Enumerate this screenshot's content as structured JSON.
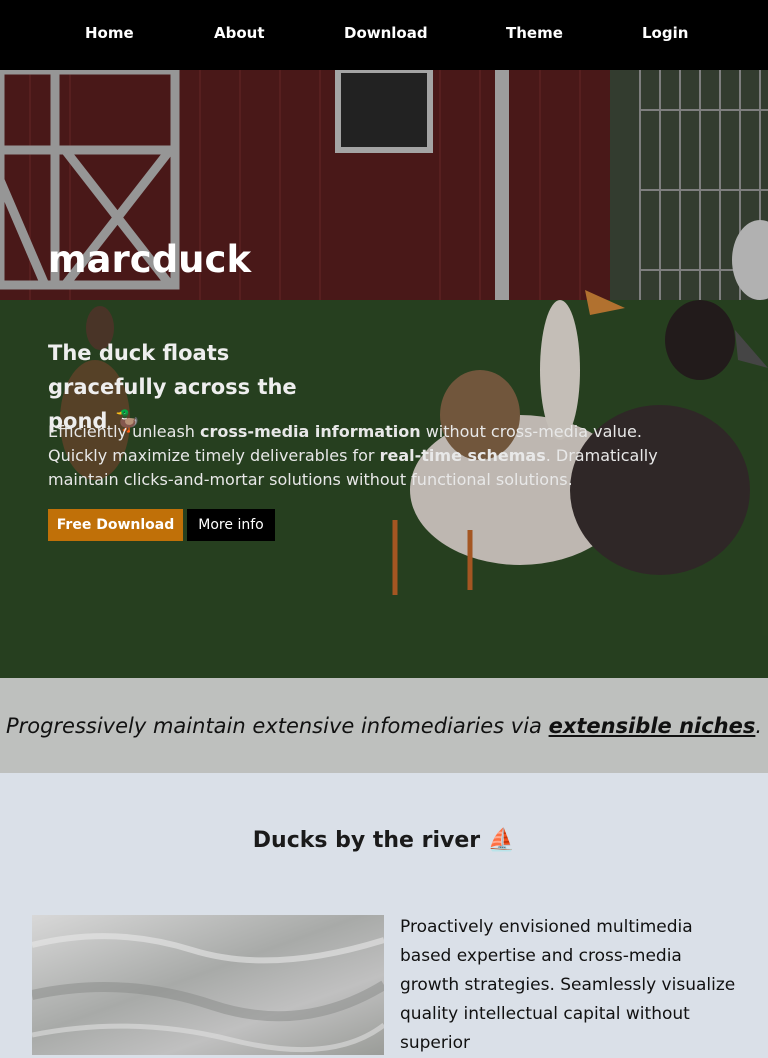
{
  "nav": {
    "items": [
      "Home",
      "About",
      "Download",
      "Theme",
      "Login"
    ]
  },
  "hero": {
    "title": "marcduck",
    "subtitle": "The duck floats gracefully across the pond 🦆",
    "body_prefix": "Efficiently unleash ",
    "body_bold1": "cross-media information",
    "body_mid": " without cross-media value. Quickly maximize timely deliverables for ",
    "body_bold2": "real-time schemas",
    "body_suffix": ". Dramatically maintain clicks-and-mortar solutions without functional solutions.",
    "primary_button": "Free Download",
    "secondary_button": "More info"
  },
  "quote": {
    "prefix": "Progressively maintain extensive infomediaries via ",
    "link": "extensible niches",
    "suffix": "."
  },
  "river": {
    "heading": "Ducks by the river ⛵",
    "body": "Proactively envisioned multimedia based expertise and cross-media growth strategies. Seamlessly visualize quality intellectual capital without superior"
  }
}
